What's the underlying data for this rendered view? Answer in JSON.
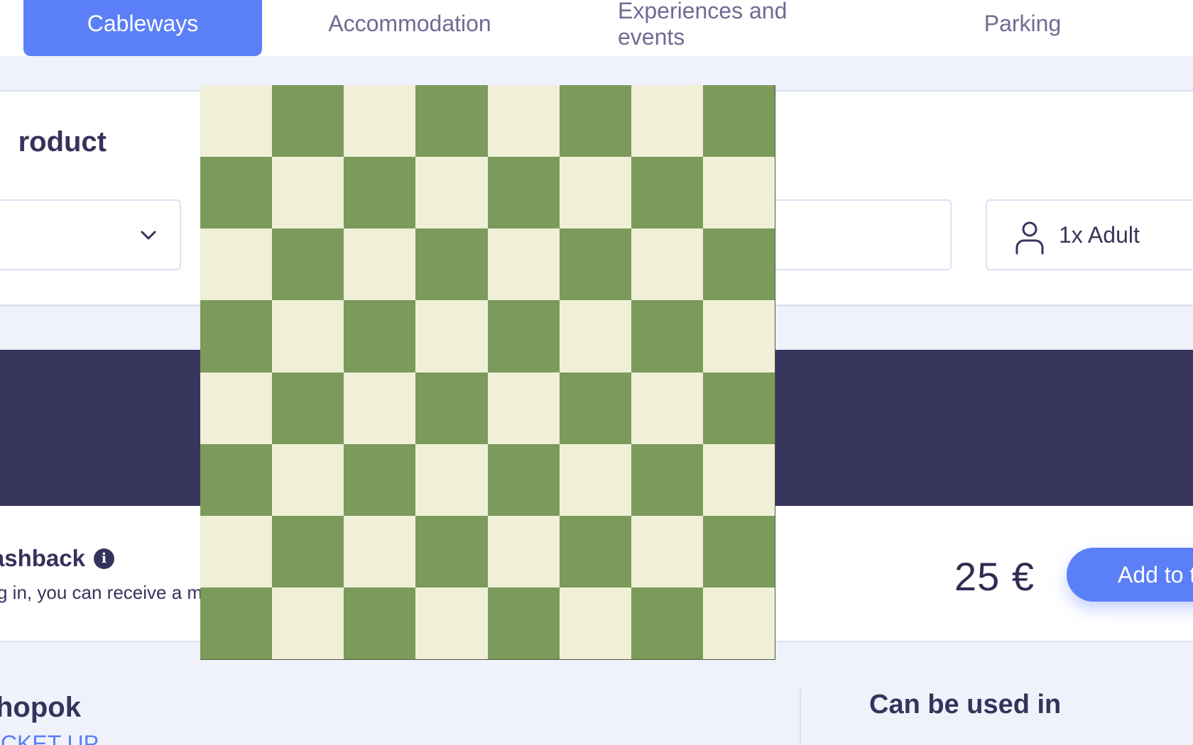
{
  "tabs": [
    {
      "label": "Cableways",
      "active": true
    },
    {
      "label": "Accommodation",
      "active": false
    },
    {
      "label": "Experiences and events",
      "active": false
    },
    {
      "label": "Parking",
      "active": false
    }
  ],
  "filter": {
    "title": "roduct",
    "select_value": "",
    "date_value": "",
    "passengers": "1x Adult"
  },
  "product": {
    "cashback_title": "ashback",
    "cashback_text": "g in, you can receive a m",
    "price": "25 €",
    "add_button": "Add to t"
  },
  "location": {
    "title": "hopok",
    "link": "ICKET UP"
  },
  "usage": {
    "title": "Can be used in"
  },
  "colors": {
    "accent": "#5b7ff7",
    "banner": "#38355c",
    "background": "#eff2fb",
    "checker_light": "#eff0d7",
    "checker_dark": "#7c9a5a"
  },
  "icons": {
    "select_chevron": "chevron-down-icon",
    "passenger": "user-icon",
    "info": "info-icon"
  }
}
